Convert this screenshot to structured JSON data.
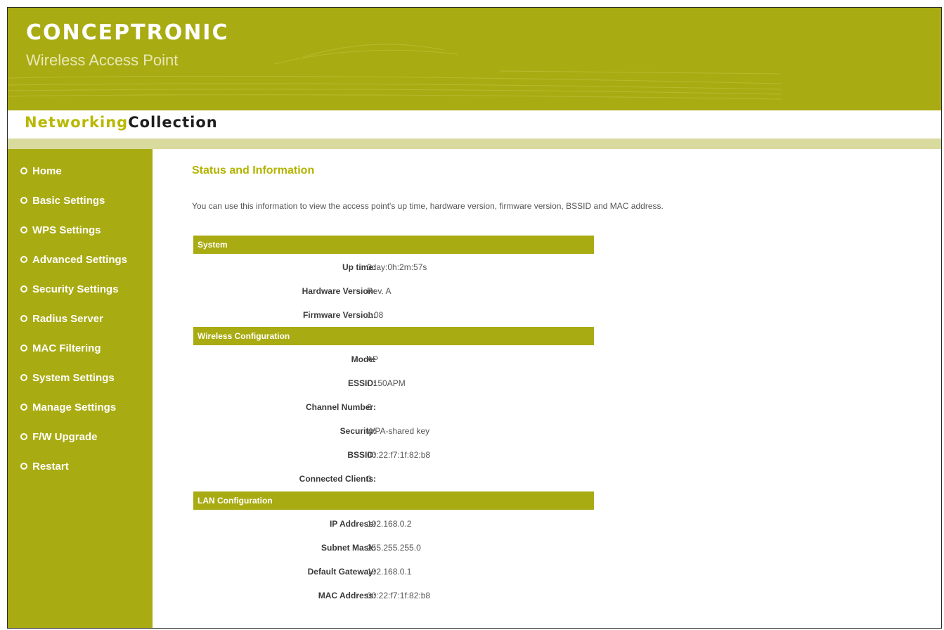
{
  "header": {
    "brand": "CONCEPTRONIC",
    "product": "Wireless Access Point"
  },
  "collection": {
    "part1": "Networking",
    "part2": "Collection"
  },
  "nav": {
    "items": [
      {
        "label": "Home"
      },
      {
        "label": "Basic Settings"
      },
      {
        "label": "WPS Settings"
      },
      {
        "label": "Advanced Settings"
      },
      {
        "label": "Security Settings"
      },
      {
        "label": "Radius Server"
      },
      {
        "label": "MAC Filtering"
      },
      {
        "label": "System Settings"
      },
      {
        "label": "Manage Settings"
      },
      {
        "label": "F/W Upgrade"
      },
      {
        "label": "Restart"
      }
    ]
  },
  "main": {
    "title": "Status and Information",
    "intro": "You can use this information to view the access point's up time, hardware version, firmware version, BSSID and MAC address.",
    "sections": [
      {
        "heading": "System",
        "rows": [
          {
            "label": "Up time:",
            "value": "0day:0h:2m:57s"
          },
          {
            "label": "Hardware Version:",
            "value": "Rev. A"
          },
          {
            "label": "Firmware Version:",
            "value": "1.08"
          }
        ]
      },
      {
        "heading": "Wireless Configuration",
        "rows": [
          {
            "label": "Mode:",
            "value": "AP"
          },
          {
            "label": "ESSID:",
            "value": "C150APM"
          },
          {
            "label": "Channel Number:",
            "value": "6"
          },
          {
            "label": "Security:",
            "value": "WPA-shared key"
          },
          {
            "label": "BSSID:",
            "value": "00:22:f7:1f:82:b8"
          },
          {
            "label": "Connected Clients:",
            "value": "0"
          }
        ]
      },
      {
        "heading": "LAN Configuration",
        "rows": [
          {
            "label": "IP Address:",
            "value": "192.168.0.2"
          },
          {
            "label": "Subnet Mask:",
            "value": "255.255.255.0"
          },
          {
            "label": "Default Gateway:",
            "value": "192.168.0.1"
          },
          {
            "label": "MAC Address:",
            "value": "00:22:f7:1f:82:b8"
          }
        ]
      }
    ]
  },
  "colors": {
    "olive": "#a9ab12",
    "band": "#d9da9d",
    "title": "#b3b300"
  }
}
